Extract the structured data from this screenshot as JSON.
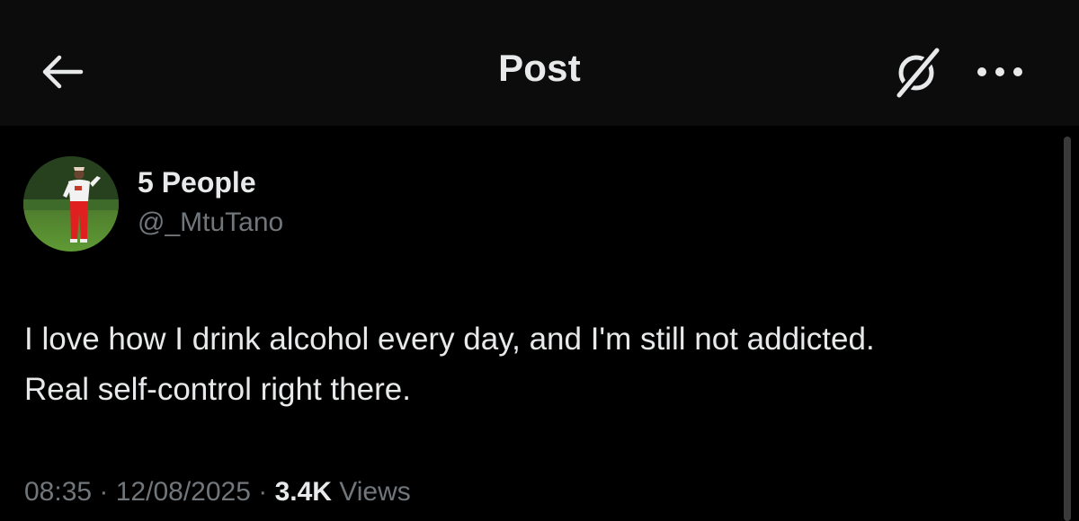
{
  "header": {
    "title": "Post",
    "back_icon": "arrow-left-icon",
    "grok_icon": "grok-icon",
    "more_icon": "more-horizontal-icon"
  },
  "post": {
    "author": {
      "display_name": "5 People",
      "handle": "@_MtuTano"
    },
    "text_line_1": "I love how I drink alcohol every day, and I'm still not addicted.",
    "text_line_2": "Real self-control right there.",
    "meta": {
      "time": "08:35",
      "separator": " · ",
      "date": "12/08/2025",
      "views_count": "3.4K",
      "views_label": " Views"
    }
  },
  "colors": {
    "background": "#000000",
    "header_background": "#0c0c0c",
    "primary_text": "#e7e9ea",
    "secondary_text": "#71767b"
  }
}
